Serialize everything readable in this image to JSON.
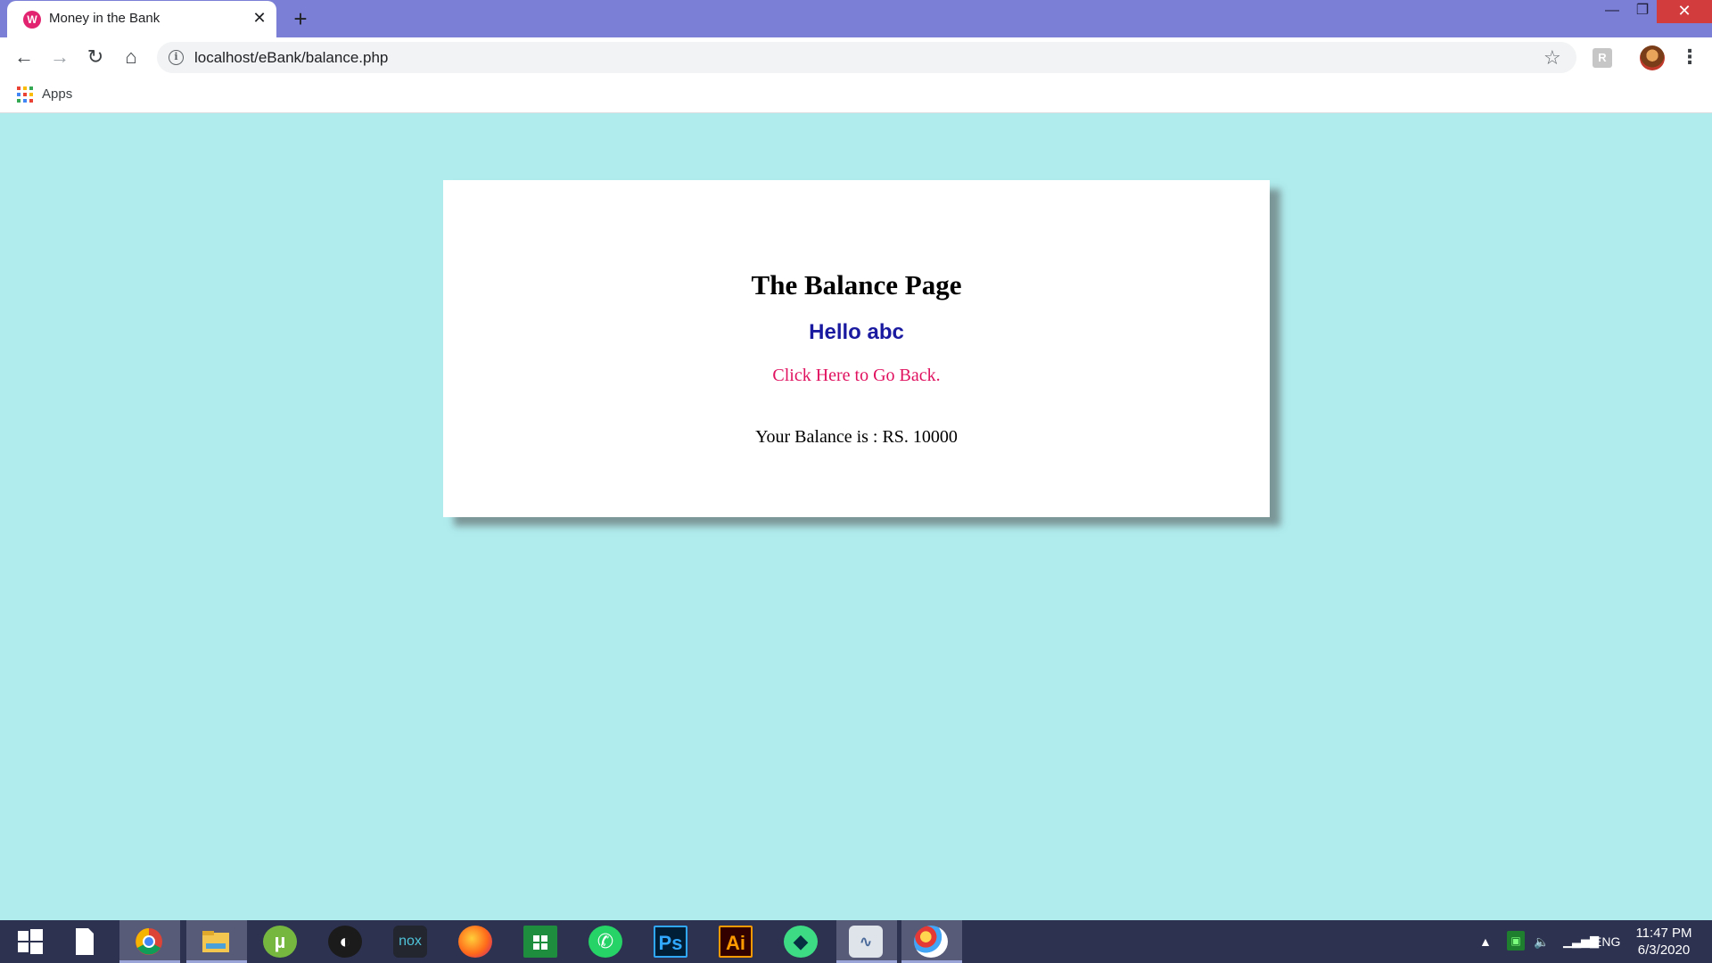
{
  "browser": {
    "tab": {
      "title": "Money in the Bank",
      "favicon": "wamp-icon",
      "close": "✕"
    },
    "new_tab": "+",
    "url": "localhost/eBank/balance.php",
    "window_controls": {
      "minimize": "—",
      "maximize": "❐",
      "close": "✕"
    },
    "nav": {
      "back": "←",
      "forward": "→",
      "reload": "↻",
      "home": "⌂"
    },
    "bookmarks": {
      "apps_label": "Apps"
    },
    "extension_icon": "R"
  },
  "page": {
    "title": "The Balance Page",
    "greeting": "Hello abc",
    "back_link": "Click Here to Go Back.",
    "balance_text": "Your Balance is : RS. 10000"
  },
  "colors": {
    "page_background": "#b0ecee",
    "card_background": "#ffffff",
    "greeting": "#1a1aa0",
    "link": "#e0115f",
    "tab_strip": "#7b80d6",
    "taskbar": "#2d3250"
  },
  "taskbar": {
    "apps": [
      {
        "name": "start-icon"
      },
      {
        "name": "file-icon"
      },
      {
        "name": "chrome-icon"
      },
      {
        "name": "file-explorer-icon"
      },
      {
        "name": "utorrent-icon"
      },
      {
        "name": "audio-app-icon"
      },
      {
        "name": "nox-icon",
        "label": "nox"
      },
      {
        "name": "firefox-icon"
      },
      {
        "name": "microsoft-store-icon"
      },
      {
        "name": "whatsapp-icon"
      },
      {
        "name": "photoshop-icon",
        "label": "Ps"
      },
      {
        "name": "illustrator-icon",
        "label": "Ai"
      },
      {
        "name": "android-studio-icon"
      },
      {
        "name": "performance-monitor-icon"
      },
      {
        "name": "paint-icon"
      }
    ],
    "tray": {
      "language": "ENG",
      "time": "11:47 PM",
      "date": "6/3/2020"
    }
  }
}
